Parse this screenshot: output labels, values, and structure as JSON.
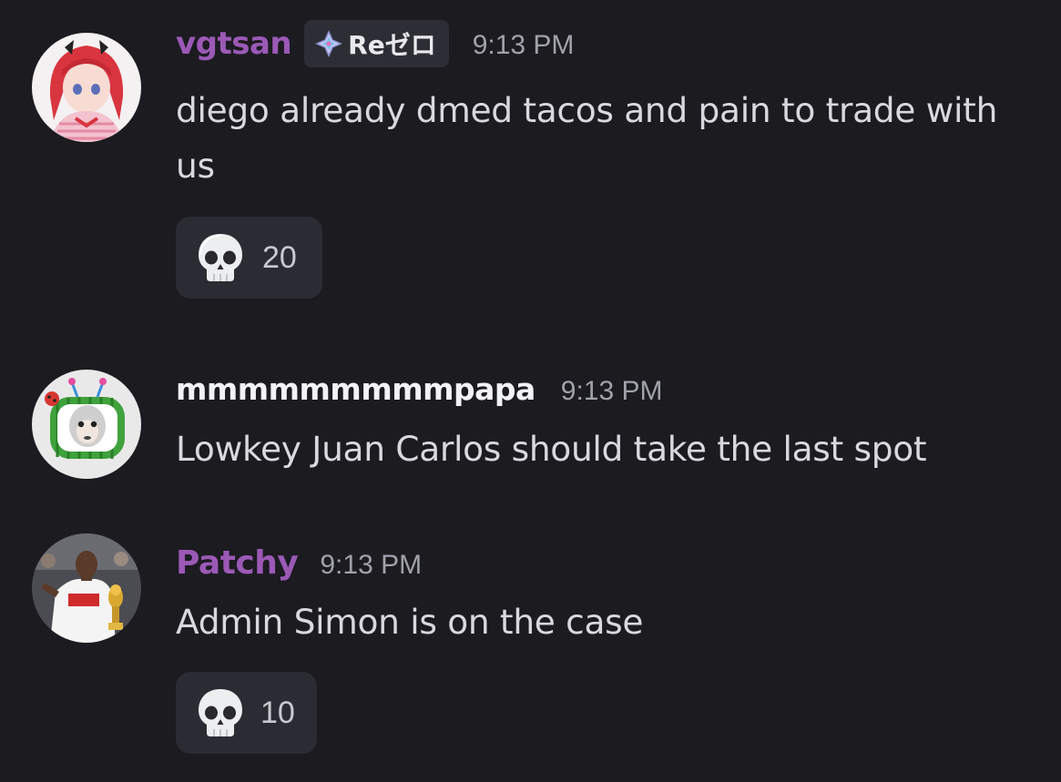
{
  "messages": [
    {
      "username": "vgtsan",
      "username_color": "#9b59b6",
      "tag": {
        "icon": "diamond-sparkle-icon",
        "label": "Reゼロ"
      },
      "timestamp": "9:13 PM",
      "text": "diego already dmed tacos and pain to trade with us",
      "reaction": {
        "emoji": "skull-emoji",
        "count": "20"
      }
    },
    {
      "username": "mmmmmmmmmpapa",
      "username_color": "#f2f3f5",
      "timestamp": "9:13 PM",
      "text": "Lowkey Juan Carlos should take the last spot"
    },
    {
      "username": "Patchy",
      "username_color": "#9b59b6",
      "timestamp": "9:13 PM",
      "text": "Admin Simon is on the case",
      "reaction": {
        "emoji": "skull-emoji",
        "count": "10"
      }
    }
  ]
}
